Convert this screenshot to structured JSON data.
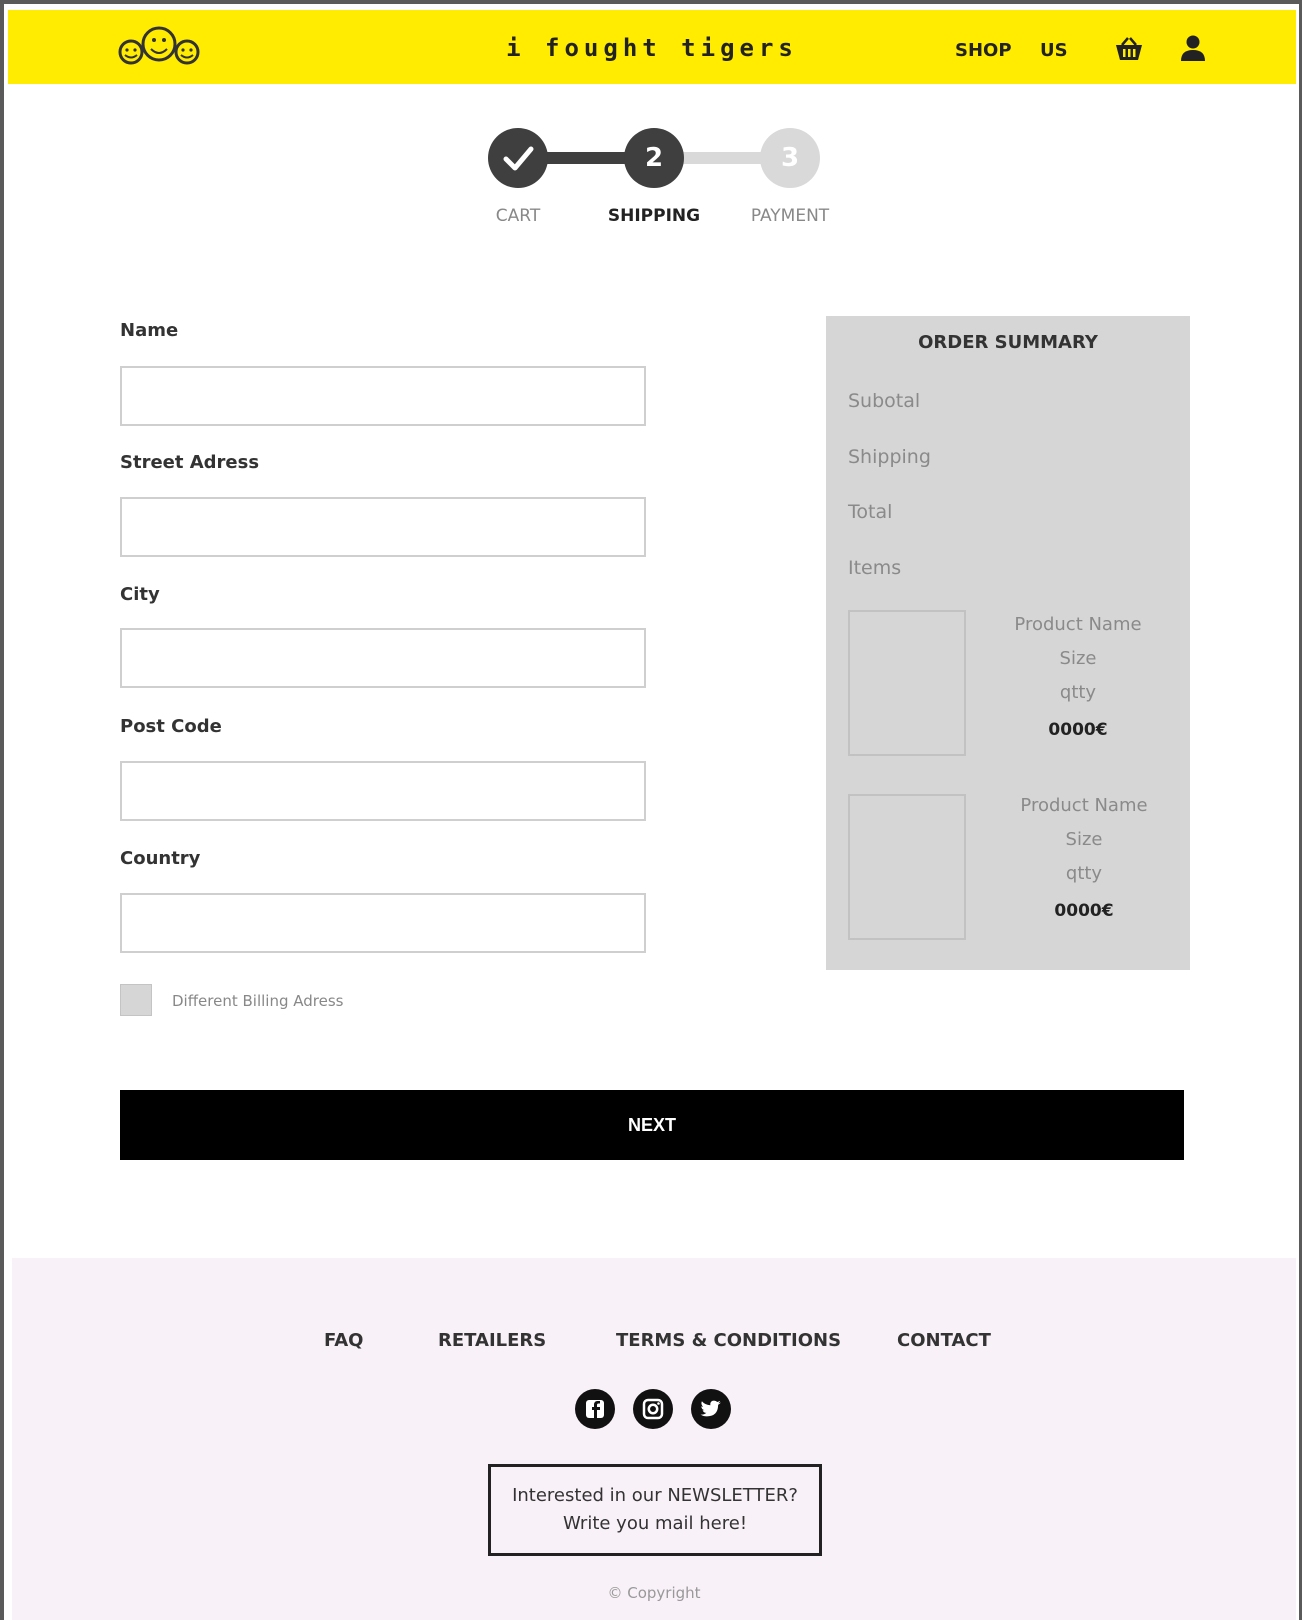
{
  "header": {
    "brand": "i fought tigers",
    "nav": {
      "shop": "SHOP",
      "us": "US"
    },
    "icons": {
      "logo": "three-smiley-faces-logo",
      "cart": "basket-icon",
      "account": "user-icon"
    },
    "accent": "#ffec00"
  },
  "stepper": {
    "steps": [
      {
        "label": "CART",
        "number": "",
        "state": "complete"
      },
      {
        "label": "SHIPPING",
        "number": "2",
        "state": "active"
      },
      {
        "label": "PAYMENT",
        "number": "3",
        "state": "todo"
      }
    ]
  },
  "form": {
    "fields": [
      {
        "label": "Name",
        "value": ""
      },
      {
        "label": "Street Adress",
        "value": ""
      },
      {
        "label": "City",
        "value": ""
      },
      {
        "label": "Post Code",
        "value": ""
      },
      {
        "label": "Country",
        "value": ""
      }
    ],
    "billing_checkbox": {
      "label": "Different Billing Adress",
      "checked": false
    }
  },
  "summary": {
    "title": "ORDER SUMMARY",
    "rows": [
      "Subotal",
      "Shipping",
      "Total",
      "Items"
    ],
    "products": [
      {
        "name": "Product Name",
        "size": "Size",
        "qty": "qtty",
        "price": "0000€"
      },
      {
        "name": "Product Name",
        "size": "Size",
        "qty": "qtty",
        "price": "0000€"
      }
    ]
  },
  "actions": {
    "next_label": "NEXT"
  },
  "footer": {
    "links": {
      "faq": "FAQ",
      "retailers": "RETAILERS",
      "terms": "TERMS & CONDITIONS",
      "contact": "CONTACT"
    },
    "social": [
      "facebook-icon",
      "instagram-icon",
      "twitter-icon"
    ],
    "newsletter_line1": "Interested in our NEWSLETTER?",
    "newsletter_line2": "Write you mail here!",
    "copyright": "© Copyright"
  }
}
